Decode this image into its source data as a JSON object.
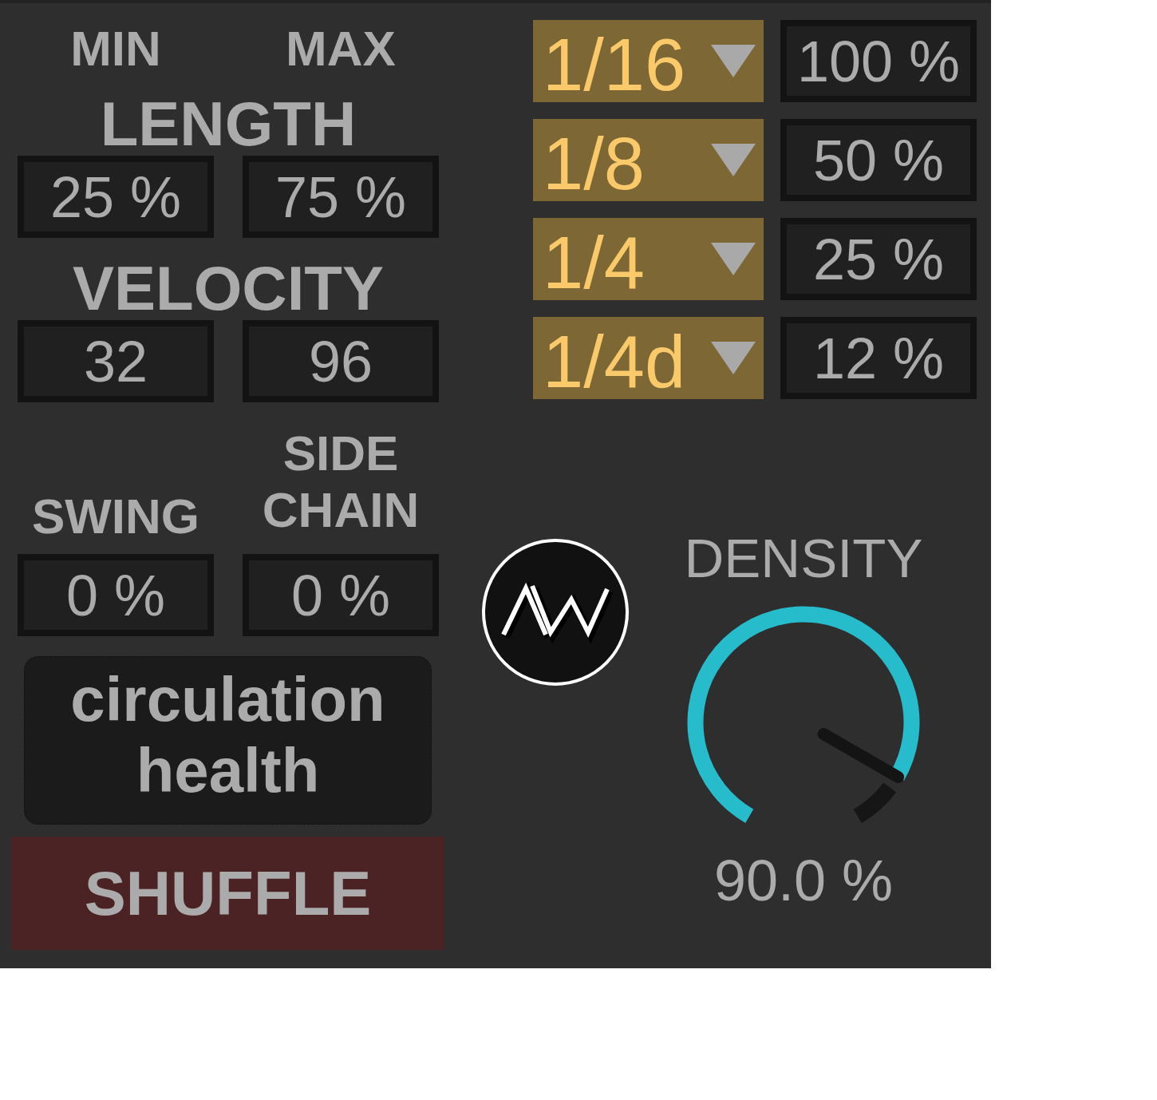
{
  "column_headers": [
    "MIN",
    "MAX"
  ],
  "parameters": [
    {
      "label": "LENGTH",
      "min": "25 %",
      "max": "75 %"
    },
    {
      "label": "VELOCITY",
      "min": "32",
      "max": "96"
    }
  ],
  "swing": {
    "label": "SWING",
    "value": "0 %"
  },
  "side_chain": {
    "label": "SIDE CHAIN",
    "value": "0 %"
  },
  "circulation_button": {
    "label": "circulation health"
  },
  "shuffle_button": {
    "label": "SHUFFLE"
  },
  "rates": [
    {
      "division": "1/16",
      "amount": "100 %"
    },
    {
      "division": "1/8",
      "amount": "50 %"
    },
    {
      "division": "1/4",
      "amount": "25 %"
    },
    {
      "division": "1/4d",
      "amount": "12 %"
    }
  ],
  "density": {
    "label": "DENSITY",
    "level": 0.9,
    "reading": "90.0 %"
  }
}
